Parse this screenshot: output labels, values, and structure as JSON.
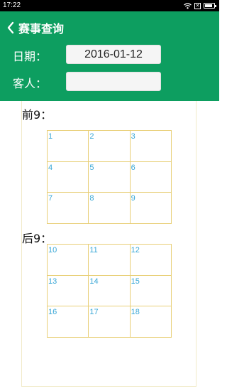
{
  "status_bar": {
    "time": "17:22",
    "battery_level": 0.85
  },
  "header": {
    "title": "赛事查询"
  },
  "form": {
    "date_label": "日期：",
    "date_value": "2016-01-12",
    "guest_label": "客人：",
    "guest_value": ""
  },
  "front_nine": {
    "label": "前9：",
    "holes": [
      "1",
      "2",
      "3",
      "4",
      "5",
      "6",
      "7",
      "8",
      "9"
    ]
  },
  "back_nine": {
    "label": "后9：",
    "holes": [
      "10",
      "11",
      "12",
      "13",
      "14",
      "15",
      "16",
      "17",
      "18"
    ]
  },
  "colors": {
    "header_green": "#0d9e60",
    "grid_line": "#e8cf77",
    "hole_number": "#39a7d6"
  }
}
